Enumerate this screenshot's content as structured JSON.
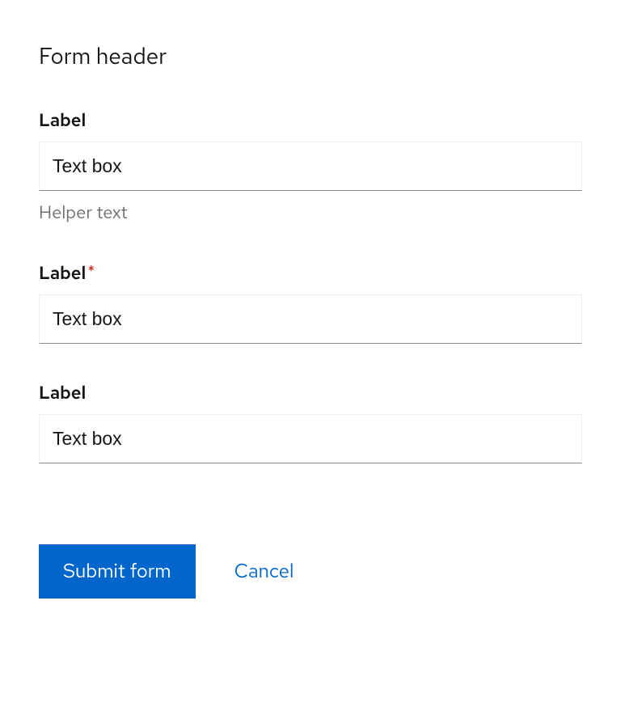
{
  "header": "Form header",
  "fields": [
    {
      "label": "Label",
      "placeholder": "Text box",
      "helper": "Helper text",
      "required": false
    },
    {
      "label": "Label",
      "placeholder": "Text box",
      "helper": "",
      "required": true
    },
    {
      "label": "Label",
      "placeholder": "Text box",
      "helper": "",
      "required": false
    }
  ],
  "required_marker": "*",
  "actions": {
    "submit": "Submit form",
    "cancel": "Cancel"
  }
}
